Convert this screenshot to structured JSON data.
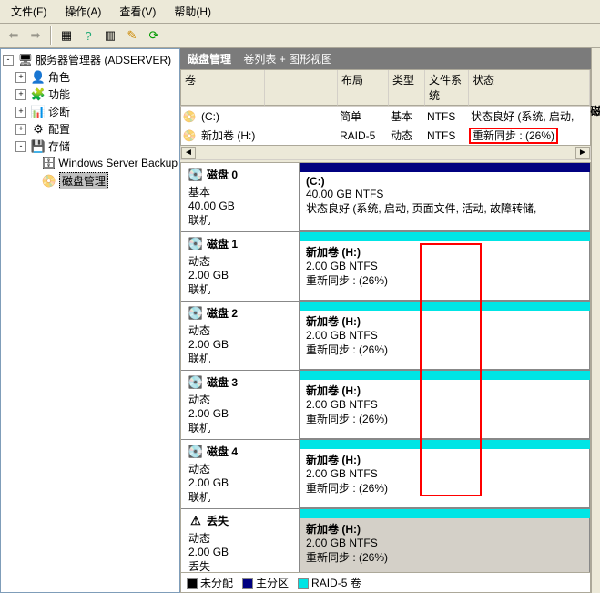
{
  "menubar": {
    "file": "文件(F)",
    "action": "操作(A)",
    "view": "查看(V)",
    "help": "帮助(H)"
  },
  "tree": {
    "root": "服务器管理器 (ADSERVER)",
    "roles": "角色",
    "features": "功能",
    "diag": "诊断",
    "config": "配置",
    "storage": "存储",
    "wsb": "Windows Server Backup",
    "diskmgmt": "磁盘管理"
  },
  "header": {
    "title": "磁盘管理",
    "subtitle": "卷列表 + 图形视图"
  },
  "cols": {
    "vol": "卷",
    "layout": "布局",
    "type": "类型",
    "fs": "文件系统",
    "status": "状态"
  },
  "volumes": [
    {
      "name": "(C:)",
      "layout": "简单",
      "type": "基本",
      "fs": "NTFS",
      "status": "状态良好 (系统, 启动,"
    },
    {
      "name": "新加卷 (H:)",
      "layout": "RAID-5",
      "type": "动态",
      "fs": "NTFS",
      "status": "重新同步 : (26%)"
    }
  ],
  "disks": [
    {
      "title": "磁盘 0",
      "dtype": "基本",
      "size": "40.00 GB",
      "state": "联机",
      "vol": "(C:)",
      "detail": "40.00 GB NTFS",
      "extra": "状态良好 (系统, 启动, 页面文件, 活动, 故障转储,",
      "stripe": "navy"
    },
    {
      "title": "磁盘 1",
      "dtype": "动态",
      "size": "2.00 GB",
      "state": "联机",
      "vol": "新加卷  (H:)",
      "detail": "2.00 GB NTFS",
      "extra": "重新同步 :  (26%)",
      "stripe": "cyan"
    },
    {
      "title": "磁盘 2",
      "dtype": "动态",
      "size": "2.00 GB",
      "state": "联机",
      "vol": "新加卷  (H:)",
      "detail": "2.00 GB NTFS",
      "extra": "重新同步 :  (26%)",
      "stripe": "cyan"
    },
    {
      "title": "磁盘 3",
      "dtype": "动态",
      "size": "2.00 GB",
      "state": "联机",
      "vol": "新加卷  (H:)",
      "detail": "2.00 GB NTFS",
      "extra": "重新同步 :  (26%)",
      "stripe": "cyan"
    },
    {
      "title": "磁盘 4",
      "dtype": "动态",
      "size": "2.00 GB",
      "state": "联机",
      "vol": "新加卷  (H:)",
      "detail": "2.00 GB NTFS",
      "extra": "重新同步 :  (26%)",
      "stripe": "cyan"
    },
    {
      "title": "丢失",
      "dtype": "动态",
      "size": "2.00 GB",
      "state": "丢失",
      "vol": "新加卷  (H:)",
      "detail": "2.00 GB NTFS",
      "extra": "重新同步 :  (26%)",
      "stripe": "cyan",
      "missing": true
    }
  ],
  "legend": {
    "unalloc": "未分配",
    "primary": "主分区",
    "raid5": "RAID-5 卷"
  }
}
